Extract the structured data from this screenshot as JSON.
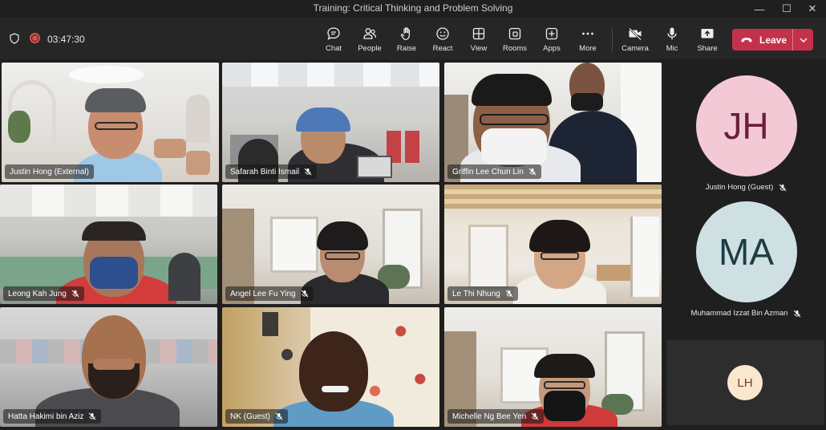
{
  "window": {
    "title": "Training: Critical Thinking and Problem Solving"
  },
  "toolbar": {
    "timer": "03:47:30",
    "buttons": [
      {
        "label": "Chat",
        "icon": "chat-icon"
      },
      {
        "label": "People",
        "icon": "people-icon"
      },
      {
        "label": "Raise",
        "icon": "raise-hand-icon"
      },
      {
        "label": "React",
        "icon": "react-icon"
      },
      {
        "label": "View",
        "icon": "view-icon"
      },
      {
        "label": "Rooms",
        "icon": "rooms-icon"
      },
      {
        "label": "Apps",
        "icon": "apps-icon"
      },
      {
        "label": "More",
        "icon": "more-icon"
      },
      {
        "label": "Camera",
        "icon": "camera-off-icon"
      },
      {
        "label": "Mic",
        "icon": "mic-icon"
      },
      {
        "label": "Share",
        "icon": "share-icon"
      }
    ],
    "leave_label": "Leave"
  },
  "participants": [
    {
      "name": "Justin Hong (External)",
      "active_speaker": true
    },
    {
      "name": "Safarah Binti Ismail"
    },
    {
      "name": "Griffin Lee Chun Lin"
    },
    {
      "name": "Leong Kah Jung"
    },
    {
      "name": "Angel Lee Fu Ying"
    },
    {
      "name": "Le Thi Nhung"
    },
    {
      "name": "Hatta Hakimi bin Aziz"
    },
    {
      "name": "NK (Guest)"
    },
    {
      "name": "Michelle Ng Bee Yen"
    }
  ],
  "side_participants": [
    {
      "initials": "JH",
      "name": "Justin Hong (Guest)",
      "bg": "#f4c9d6",
      "fg": "#6b1f38"
    },
    {
      "initials": "MA",
      "name": "Muhammad Izzat Bin Azman",
      "bg": "#cfe0e3",
      "fg": "#1e3c44"
    },
    {
      "initials": "LH",
      "bg": "#fbe6cf",
      "fg": "#6b4220"
    }
  ],
  "colors": {
    "leave": "#c4314b",
    "active_outline": "#7f85f5"
  }
}
